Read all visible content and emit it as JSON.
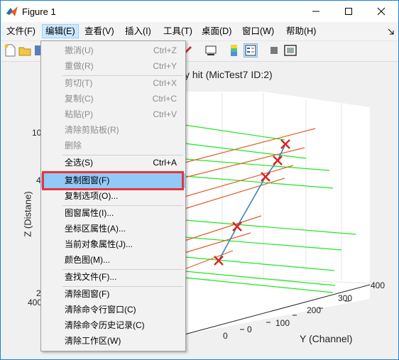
{
  "window": {
    "title": "Figure 1"
  },
  "menubar": [
    "文件(F)",
    "编辑(E)",
    "查看(V)",
    "插入(I)",
    "工具(T)",
    "桌面(D)",
    "窗口(W)",
    "帮助(H)"
  ],
  "edit_menu": {
    "items": [
      {
        "label": "撤消(U)",
        "shortcut": "Ctrl+Z"
      },
      {
        "label": "重做(R)",
        "shortcut": "Ctrl+Y"
      },
      {
        "label": "剪切(T)",
        "shortcut": "Ctrl+X"
      },
      {
        "label": "复制(C)",
        "shortcut": "Ctrl+C"
      },
      {
        "label": "粘贴(P)",
        "shortcut": "Ctrl+V"
      },
      {
        "label": "清除剪贴板(R)",
        "shortcut": ""
      },
      {
        "label": "删除",
        "shortcut": ""
      },
      {
        "label": "全选(S)",
        "shortcut": "Ctrl+A"
      },
      {
        "label": "复制图窗(F)",
        "shortcut": ""
      },
      {
        "label": "复制选项(O)...",
        "shortcut": ""
      },
      {
        "label": "图窗属性(I)...",
        "shortcut": ""
      },
      {
        "label": "坐标区属性(A)...",
        "shortcut": ""
      },
      {
        "label": "当前对象属性(J)...",
        "shortcut": ""
      },
      {
        "label": "颜色图(M)...",
        "shortcut": ""
      },
      {
        "label": "查找文件(F)...",
        "shortcut": ""
      },
      {
        "label": "清除图窗(F)",
        "shortcut": ""
      },
      {
        "label": "清除命令行窗口(C)",
        "shortcut": ""
      },
      {
        "label": "清除命令历史记录(C)",
        "shortcut": ""
      },
      {
        "label": "清除工作区(W)",
        "shortcut": ""
      }
    ]
  },
  "plot": {
    "title_fragment": "y hit (MicTest7 ID:2)",
    "zlabel": "Z (Distane)",
    "ylabel": "Y (Channel)",
    "z_tick_fragments": [
      "10",
      "4",
      "2",
      "400"
    ],
    "y_ticks": [
      "0",
      "100",
      "200",
      "300",
      "400"
    ]
  },
  "colors": {
    "green": "#1fe61f",
    "orange": "#e0602a",
    "blue": "#2f7fc1",
    "marker": "#e0201f",
    "highlight": "#e8343d"
  }
}
